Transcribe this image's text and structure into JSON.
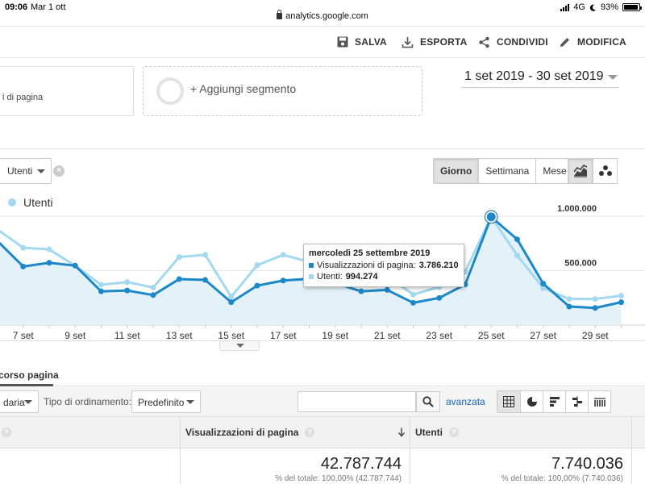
{
  "status_bar": {
    "time": "09:06",
    "date": "Mar 1 ott",
    "url": "analytics.google.com",
    "network": "4G",
    "battery": "93%",
    "battery_level": 0.93
  },
  "toolbar": {
    "save": "SALVA",
    "export": "ESPORTA",
    "share": "CONDIVIDI",
    "edit": "MODIFICA"
  },
  "segments": {
    "segment_label": "i di pagina",
    "add_segment": "+ Aggiungi segmento"
  },
  "date_range": "1 set 2019 - 30 set 2019",
  "metric_selector": "Utenti",
  "period_buttons": [
    "Giorno",
    "Settimana",
    "Mese"
  ],
  "active_period": "Giorno",
  "legend_label": "Utenti",
  "tooltip": {
    "title": "mercoledì 25 settembre 2019",
    "row1_label": "Visualizzazioni di pagina:",
    "row1_value": "3.786.210",
    "row2_label": "Utenti:",
    "row2_value": "994.274"
  },
  "chart_data": {
    "type": "line",
    "title": "",
    "xlabel": "",
    "ylabel": "",
    "x_tick_labels": [
      "7 set",
      "9 set",
      "11 set",
      "13 set",
      "15 set",
      "17 set",
      "19 set",
      "21 set",
      "23 set",
      "25 set",
      "27 set",
      "29 set"
    ],
    "y_tick_labels": [
      "1.000.000",
      "500.000"
    ],
    "y_ticks": [
      1000000,
      500000
    ],
    "ylim": [
      0,
      1150000
    ],
    "x": [
      "6 set",
      "7 set",
      "8 set",
      "9 set",
      "10 set",
      "11 set",
      "12 set",
      "13 set",
      "14 set",
      "15 set",
      "16 set",
      "17 set",
      "18 set",
      "19 set",
      "20 set",
      "21 set",
      "22 set",
      "23 set",
      "24 set",
      "25 set",
      "26 set",
      "27 set",
      "28 set",
      "29 set",
      "30 set"
    ],
    "series": [
      {
        "name": "Utenti",
        "color": "#a4d8ef",
        "area": false,
        "values": [
          880000,
          710000,
          695000,
          545000,
          370000,
          395000,
          345000,
          625000,
          645000,
          260000,
          550000,
          645000,
          580000,
          600000,
          555000,
          450000,
          280000,
          350000,
          490000,
          994274,
          640000,
          340000,
          240000,
          240000,
          270000
        ]
      },
      {
        "name": "Visualizzazioni di pagina",
        "color": "#1c88c7",
        "area": true,
        "values": [
          2950000,
          2050000,
          2180000,
          2080000,
          1180000,
          1210000,
          1050000,
          1610000,
          1580000,
          800000,
          1380000,
          1560000,
          1620000,
          1470000,
          1180000,
          1230000,
          780000,
          950000,
          1420000,
          3786210,
          3000000,
          1450000,
          650000,
          600000,
          800000
        ]
      }
    ],
    "secondary_axis_scale": 0.2625,
    "highlight_index": 19
  },
  "table_section_title": "corso pagina",
  "table_controls": {
    "dimension_dropdown": "daria",
    "sort_label": "Tipo di ordinamento:",
    "sort_value": "Predefinito",
    "advanced_link": "avanzata"
  },
  "table": {
    "col1_header": "Visualizzazioni di pagina",
    "col2_header": "Utenti",
    "col1_total": "42.787.744",
    "col1_sub": "% del totale: 100,00% (42.787.744)",
    "col2_total": "7.740.036",
    "col2_sub": "% del totale: 100,00% (7.740.036)"
  }
}
